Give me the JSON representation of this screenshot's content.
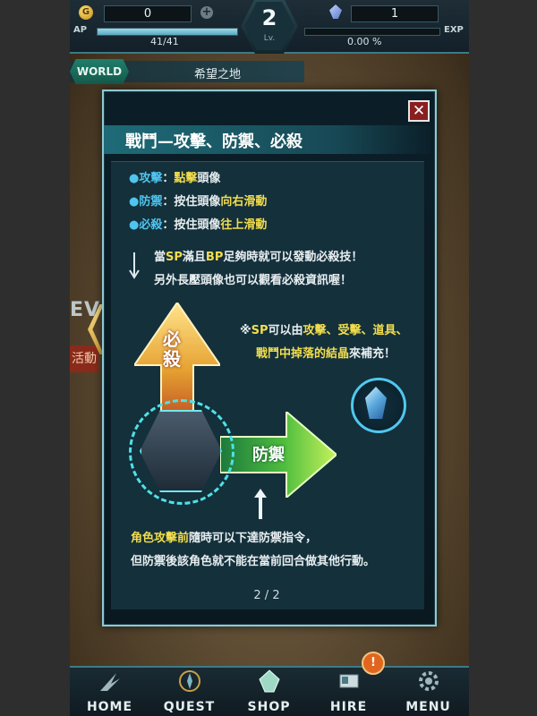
{
  "hud": {
    "gold_icon": "G",
    "gold": "0",
    "crystals": "1",
    "ap_label": "AP",
    "ap_value": "41/41",
    "ap_fraction": 1.0,
    "level": "2",
    "level_label": "Lv.",
    "exp_label": "EXP",
    "exp_value": "0.00 %"
  },
  "world": {
    "tag": "WORLD",
    "name": "希望之地"
  },
  "side": {
    "event_text": "EV",
    "red_text": "活動"
  },
  "dialog": {
    "close_label": "✕",
    "title": "戰鬥—攻擊、防禦、必殺",
    "bullets": [
      {
        "bullet": "●",
        "key": "攻擊",
        "sep": "：",
        "desc_a": "",
        "highlight": "點擊",
        "desc_b": "頭像"
      },
      {
        "bullet": "●",
        "key": "防禦",
        "sep": "：",
        "desc_a": "按住頭像",
        "highlight": "向右滑動",
        "desc_b": ""
      },
      {
        "bullet": "●",
        "key": "必殺",
        "sep": "：",
        "desc_a": "按住頭像",
        "highlight": "往上滑動",
        "desc_b": ""
      }
    ],
    "sp_line1": {
      "a": "當",
      "sp": "SP",
      "b": "滿且",
      "bp": "BP",
      "c": "足夠時就可以發動必殺技！"
    },
    "sp_line2": "另外長壓頭像也可以觀看必殺資訊喔！",
    "sp_note1": {
      "a": "※",
      "sp": "SP",
      "b": "可以由",
      "h": "攻擊、受擊、道具、"
    },
    "sp_note2": {
      "h": "戰鬥中掉落的結晶",
      "b": "來補充！"
    },
    "special_label": "必殺",
    "defend_label": "防禦",
    "tip1": {
      "h": "角色攻擊前",
      "b": "隨時可以下達防禦指令，"
    },
    "tip2": "但防禦後該角色就不能在當前回合做其他行動。",
    "page": "2 / 2"
  },
  "nav": [
    {
      "label": "HOME",
      "icon": "home-wing-icon"
    },
    {
      "label": "QUEST",
      "icon": "compass-icon"
    },
    {
      "label": "SHOP",
      "icon": "crystal-shop-icon"
    },
    {
      "label": "HIRE",
      "icon": "card-hire-icon"
    },
    {
      "label": "MENU",
      "icon": "gear-icon"
    }
  ],
  "hire_badge": "!",
  "colors": {
    "accent": "#4fc4ef",
    "highlight": "#f2dd4d",
    "frame": "#8fc8d4"
  }
}
